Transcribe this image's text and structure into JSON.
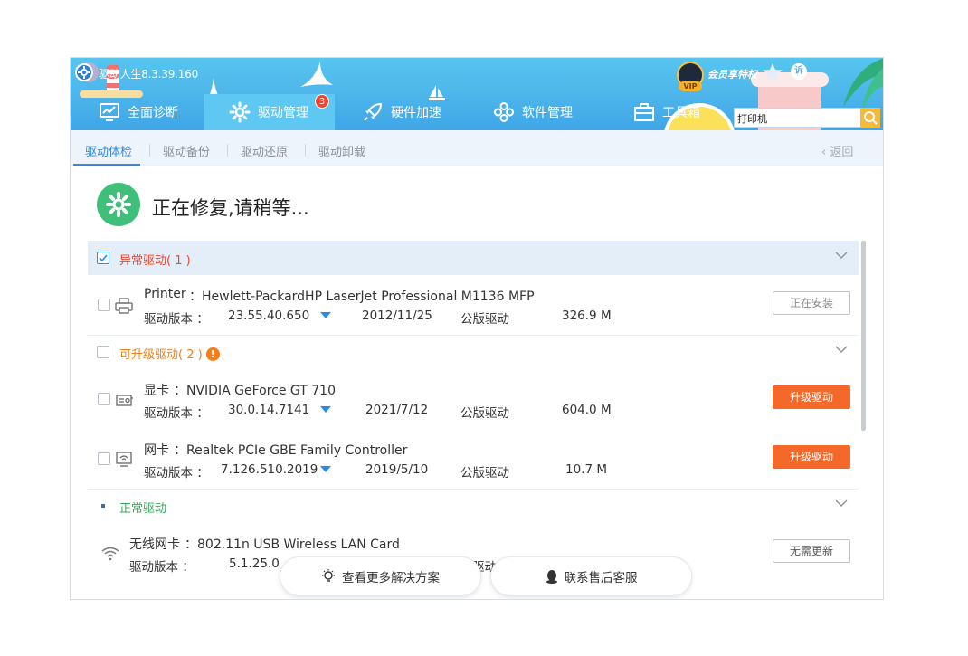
{
  "app": {
    "title": "驱动人生8.3.39.160"
  },
  "nav": [
    {
      "label": "全面诊断",
      "icon": "monitor-chart-icon"
    },
    {
      "label": "驱动管理",
      "icon": "gear-icon",
      "badge": "3"
    },
    {
      "label": "硬件加速",
      "icon": "rocket-icon"
    },
    {
      "label": "软件管理",
      "icon": "apps-icon"
    },
    {
      "label": "工具箱",
      "icon": "toolbox-icon"
    }
  ],
  "vip": {
    "tag": "VIP",
    "text": "会员享特权",
    "report_label": "诉"
  },
  "search": {
    "value": "打印机"
  },
  "subtabs": {
    "items": [
      "驱动体检",
      "驱动备份",
      "驱动还原",
      "驱动卸载"
    ],
    "back": "返回"
  },
  "status": {
    "text": "正在修复,请稍等..."
  },
  "sections": {
    "abnormal": {
      "title": "异常驱动( 1 )"
    },
    "upgradable": {
      "title": "可升级驱动( 2 )",
      "warn": "!"
    },
    "normal": {
      "title": "正常驱动"
    }
  },
  "labels": {
    "version": "驱动版本 ："
  },
  "drivers": {
    "printer": {
      "category": "Printer",
      "name": "：Hewlett-PackardHP LaserJet Professional M1136 MFP",
      "version": "23.55.40.650",
      "date": "2012/11/25",
      "type": "公版驱动",
      "size": "326.9 M",
      "action": "正在安装"
    },
    "gpu": {
      "category": "显卡",
      "name": "：NVIDIA GeForce GT 710",
      "version": "30.0.14.7141",
      "date": "2021/7/12",
      "type": "公版驱动",
      "size": "604.0 M",
      "action": "升级驱动"
    },
    "nic": {
      "category": "网卡",
      "name": "：Realtek PCIe GBE Family Controller",
      "version": "7.126.510.2019",
      "date": "2019/5/10",
      "type": "公版驱动",
      "size": "10.7 M",
      "action": "升级驱动"
    },
    "wifi": {
      "category": "无线网卡",
      "name": "：802.11n USB Wireless LAN Card",
      "version": "5.1.25.0",
      "type_partial": "驱动",
      "action": "无需更新"
    }
  },
  "footer": {
    "solutions": "查看更多解决方案",
    "support": "联系售后客服"
  },
  "colors": {
    "primary": "#2e8ae6",
    "danger": "#f4442e",
    "orange": "#f4692a",
    "warn": "#f27e1c",
    "normal": "#3aa55d",
    "header": "#4cb4ea"
  }
}
